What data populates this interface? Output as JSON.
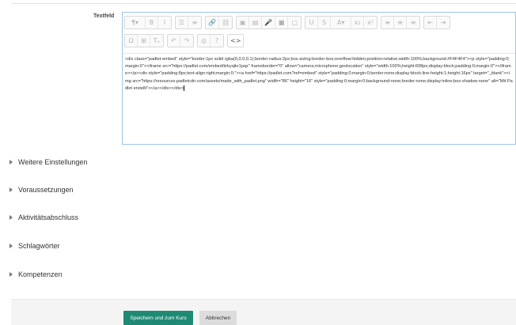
{
  "field": {
    "label": "Textfeld"
  },
  "toolbar": {
    "row1": [
      [
        {
          "icon": "¶▾",
          "name": "paragraph-format-icon",
          "wide": true
        },
        {
          "icon": "B",
          "name": "bold-icon"
        },
        {
          "icon": "I",
          "name": "italic-icon"
        }
      ],
      [
        {
          "icon": "☰",
          "name": "unordered-list-icon"
        },
        {
          "icon": "≡",
          "name": "ordered-list-icon"
        }
      ],
      [
        {
          "icon": "🔗",
          "name": "link-icon"
        },
        {
          "icon": "⛓",
          "name": "unlink-icon"
        }
      ],
      [
        {
          "icon": "▣",
          "name": "image-icon"
        },
        {
          "icon": "▤",
          "name": "media-icon"
        },
        {
          "icon": "🎤",
          "name": "record-audio-icon"
        },
        {
          "icon": "■",
          "name": "record-video-icon"
        },
        {
          "icon": "▢",
          "name": "manage-files-icon"
        }
      ],
      [
        {
          "icon": "U",
          "name": "underline-icon"
        },
        {
          "icon": "S",
          "name": "strikethrough-icon"
        },
        {
          "icon": "A▾",
          "name": "font-color-icon",
          "wide": true
        },
        {
          "icon": "x₂",
          "name": "subscript-icon"
        },
        {
          "icon": "x²",
          "name": "superscript-icon"
        }
      ],
      [
        {
          "icon": "≡",
          "name": "align-left-icon"
        },
        {
          "icon": "≡",
          "name": "align-center-icon"
        },
        {
          "icon": "≡",
          "name": "align-right-icon"
        }
      ],
      [
        {
          "icon": "⇤",
          "name": "outdent-icon"
        },
        {
          "icon": "⇥",
          "name": "indent-icon"
        }
      ]
    ],
    "row2": [
      [
        {
          "icon": "Ω",
          "name": "special-character-icon"
        },
        {
          "icon": "⊞",
          "name": "table-icon"
        },
        {
          "icon": "Tₓ",
          "name": "clear-formatting-icon"
        }
      ],
      [
        {
          "icon": "↶",
          "name": "undo-icon"
        },
        {
          "icon": "↷",
          "name": "redo-icon"
        }
      ],
      [
        {
          "icon": "◎",
          "name": "accessibility-checker-icon"
        },
        {
          "icon": "?",
          "name": "screenreader-helper-icon"
        }
      ],
      [
        {
          "icon": "<>",
          "name": "html-source-icon",
          "active": true
        }
      ]
    ]
  },
  "editor": {
    "content": "<div class=\"padlet-embed\" style=\"border:1px solid rgba(0,0,0,0.1);border-radius:2px;box-sizing:border-box;overflow:hidden;position:relative;width:100%;background:#F4F4F4\"><p style=\"padding:0;margin:0\"><iframe src=\"https://padlet.com/embed/krkyqikr1pqz\" frameborder=\"0\" allow=\"camera;microphone;geolocation\" style=\"width:100%;height:608px;display:block;padding:0;margin:0\"></iframe></p><div style=\"padding:8px;text-align:right;margin:0;\"><a href=\"https://padlet.com?ref=embed\" style=\"padding:0;margin:0;border:none;display:block;line-height:1;height:16px\" target=\"_blank\"><img src=\"https://resources.padletcdn.com/assets/made_with_padlet.png\" width=\"86\" height=\"16\" style=\"padding:0;margin:0;background:none;border:none;display:inline;box-shadow:none\" alt=\"Mit Padlet erstellt\"></a></div></div>"
  },
  "sections": [
    {
      "title": "Weitere Einstellungen"
    },
    {
      "title": "Voraussetzungen"
    },
    {
      "title": "Aktivitätsabschluss"
    },
    {
      "title": "Schlagwörter"
    },
    {
      "title": "Kompetenzen"
    }
  ],
  "buttons": {
    "save": "Speichern und zum Kurs",
    "cancel": "Abbrechen"
  },
  "colors": {
    "primary": "#1f8a74",
    "editor_border": "#9ec6e8"
  }
}
